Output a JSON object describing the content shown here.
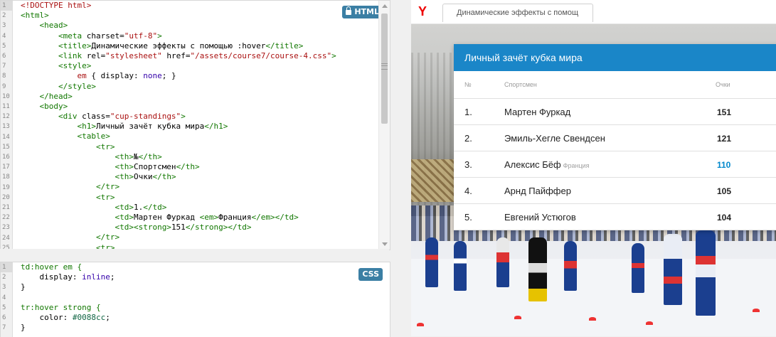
{
  "html_editor": {
    "badge_label": "HTML",
    "line_numbers": [
      "1",
      "2",
      "3",
      "4",
      "5",
      "6",
      "7",
      "8",
      "9",
      "10",
      "11",
      "12",
      "13",
      "14",
      "15",
      "16",
      "17",
      "18",
      "19",
      "20",
      "21",
      "22",
      "23",
      "24",
      "25"
    ],
    "lines": [
      [
        {
          "t": "<!DOCTYPE html>",
          "c": "doc"
        }
      ],
      [
        {
          "t": "<html>",
          "c": "tag"
        }
      ],
      [
        {
          "t": "    <head>",
          "c": "tag"
        }
      ],
      [
        {
          "t": "        <meta ",
          "c": "tag"
        },
        {
          "t": "charset=",
          "c": "attr"
        },
        {
          "t": "\"utf-8\"",
          "c": "val"
        },
        {
          "t": ">",
          "c": "tag"
        }
      ],
      [
        {
          "t": "        <title>",
          "c": "tag"
        },
        {
          "t": "Динамические эффекты с помощью :hover",
          "c": "text"
        },
        {
          "t": "</title>",
          "c": "tag"
        }
      ],
      [
        {
          "t": "        <link ",
          "c": "tag"
        },
        {
          "t": "rel=",
          "c": "attr"
        },
        {
          "t": "\"stylesheet\"",
          "c": "val"
        },
        {
          "t": " href=",
          "c": "attr"
        },
        {
          "t": "\"/assets/course7/course-4.css\"",
          "c": "val"
        },
        {
          "t": ">",
          "c": "tag"
        }
      ],
      [
        {
          "t": "        <style>",
          "c": "tag"
        }
      ],
      [
        {
          "t": "            em ",
          "c": "val"
        },
        {
          "t": "{ ",
          "c": "text"
        },
        {
          "t": "display",
          "c": "text"
        },
        {
          "t": ": ",
          "c": "text"
        },
        {
          "t": "none",
          "c": "kw"
        },
        {
          "t": "; }",
          "c": "text"
        }
      ],
      [
        {
          "t": "        </style>",
          "c": "tag"
        }
      ],
      [
        {
          "t": "    </head>",
          "c": "tag"
        }
      ],
      [
        {
          "t": "    <body>",
          "c": "tag"
        }
      ],
      [
        {
          "t": "        <div ",
          "c": "tag"
        },
        {
          "t": "class=",
          "c": "attr"
        },
        {
          "t": "\"cup-standings\"",
          "c": "val"
        },
        {
          "t": ">",
          "c": "tag"
        }
      ],
      [
        {
          "t": "            <h1>",
          "c": "tag"
        },
        {
          "t": "Личный зачёт кубка мира",
          "c": "text"
        },
        {
          "t": "</h1>",
          "c": "tag"
        }
      ],
      [
        {
          "t": "            <table>",
          "c": "tag"
        }
      ],
      [
        {
          "t": "                <tr>",
          "c": "tag"
        }
      ],
      [
        {
          "t": "                    <th>",
          "c": "tag"
        },
        {
          "t": "№",
          "c": "text"
        },
        {
          "t": "</th>",
          "c": "tag"
        }
      ],
      [
        {
          "t": "                    <th>",
          "c": "tag"
        },
        {
          "t": "Спортсмен",
          "c": "text"
        },
        {
          "t": "</th>",
          "c": "tag"
        }
      ],
      [
        {
          "t": "                    <th>",
          "c": "tag"
        },
        {
          "t": "Очки",
          "c": "text"
        },
        {
          "t": "</th>",
          "c": "tag"
        }
      ],
      [
        {
          "t": "                </tr>",
          "c": "tag"
        }
      ],
      [
        {
          "t": "                <tr>",
          "c": "tag"
        }
      ],
      [
        {
          "t": "                    <td>",
          "c": "tag"
        },
        {
          "t": "1.",
          "c": "text"
        },
        {
          "t": "</td>",
          "c": "tag"
        }
      ],
      [
        {
          "t": "                    <td>",
          "c": "tag"
        },
        {
          "t": "Мартен Фуркад ",
          "c": "text"
        },
        {
          "t": "<em>",
          "c": "tag"
        },
        {
          "t": "Франция",
          "c": "text"
        },
        {
          "t": "</em></td>",
          "c": "tag"
        }
      ],
      [
        {
          "t": "                    <td>",
          "c": "tag"
        },
        {
          "t": "<strong>",
          "c": "tag"
        },
        {
          "t": "151",
          "c": "text"
        },
        {
          "t": "</strong></td>",
          "c": "tag"
        }
      ],
      [
        {
          "t": "                </tr>",
          "c": "tag"
        }
      ],
      [
        {
          "t": "                <tr>",
          "c": "tag"
        }
      ]
    ]
  },
  "css_editor": {
    "badge_label": "CSS",
    "line_numbers": [
      "1",
      "2",
      "3",
      "4",
      "5",
      "6",
      "7"
    ],
    "lines": [
      [
        {
          "t": "td:hover em {",
          "c": "tag"
        }
      ],
      [
        {
          "t": "    display",
          "c": "text"
        },
        {
          "t": ": ",
          "c": "text"
        },
        {
          "t": "inline",
          "c": "kw"
        },
        {
          "t": ";",
          "c": "text"
        }
      ],
      [
        {
          "t": "}",
          "c": "text"
        }
      ],
      [
        {
          "t": "",
          "c": "text"
        }
      ],
      [
        {
          "t": "tr:hover strong {",
          "c": "tag"
        }
      ],
      [
        {
          "t": "    color",
          "c": "text"
        },
        {
          "t": ": ",
          "c": "text"
        },
        {
          "t": "#0088cc",
          "c": "num"
        },
        {
          "t": ";",
          "c": "text"
        }
      ],
      [
        {
          "t": "}",
          "c": "text"
        }
      ]
    ]
  },
  "browser": {
    "logo": "Y",
    "tab_title": "Динамические эффекты с помощ"
  },
  "standings": {
    "title": "Личный зачёт кубка мира",
    "headers": {
      "num": "№",
      "athlete": "Спортсмен",
      "points": "Очки"
    },
    "rows": [
      {
        "num": "1.",
        "name": "Мартен Фуркад",
        "country": "",
        "points": "151",
        "hover": false
      },
      {
        "num": "2.",
        "name": "Эмиль-Хегле Свендсен",
        "country": "",
        "points": "121",
        "hover": false
      },
      {
        "num": "3.",
        "name": "Алексис Бёф",
        "country": "Франция",
        "points": "110",
        "hover": true
      },
      {
        "num": "4.",
        "name": "Арнд Пайффер",
        "country": "",
        "points": "105",
        "hover": false
      },
      {
        "num": "5.",
        "name": "Евгений Устюгов",
        "country": "",
        "points": "104",
        "hover": false
      }
    ],
    "accent_color": "#1a86c8",
    "hover_points_color": "#0088cc"
  }
}
